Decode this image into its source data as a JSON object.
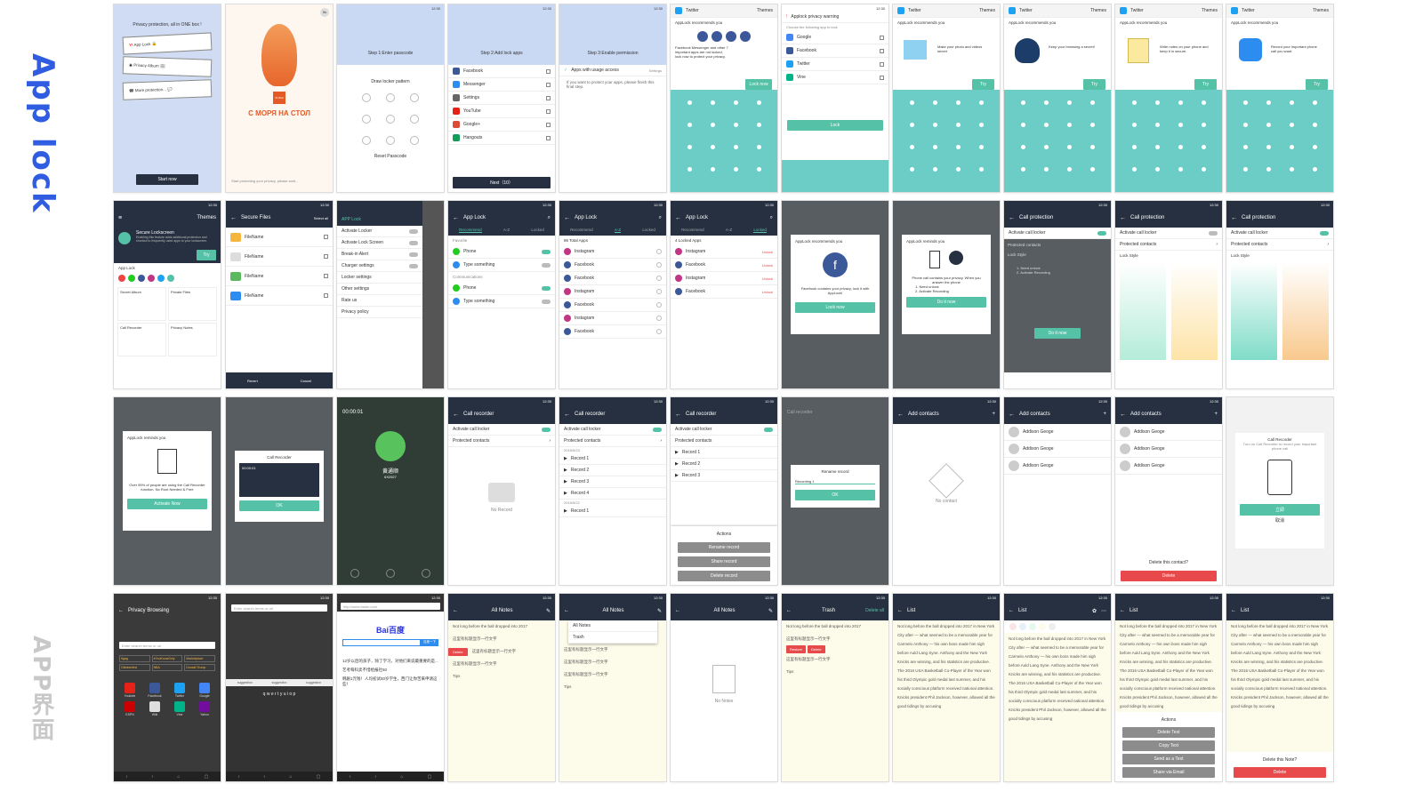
{
  "labels": {
    "app_lock": "App lock",
    "app_ui": "APP界面"
  },
  "colors": {
    "teal": "#6ccdc6",
    "green": "#55c2a8",
    "navy": "#263040",
    "red": "#e8494a",
    "blue_title": "#2f5ce0",
    "grey_title": "#c8c8c8"
  },
  "status_time": "12:30",
  "row1": {
    "p1": {
      "headline": "Privacy protection, all in ONE box !",
      "items": [
        "App Lock",
        "Privacy Album",
        "More protection..."
      ],
      "button": "Start now"
    },
    "p2": {
      "badge": "5s",
      "brand": "SUSHI",
      "slogan": "С МОРЯ НА СТОЛ",
      "footer": "Start protecting your privacy, please wait..."
    },
    "p3": {
      "step": "Step 1:Enter passcode",
      "prompt": "Draw locker pattern",
      "reset": "Reset Passcode"
    },
    "p4": {
      "step": "Step 2:Add lock apps",
      "apps": [
        "Facebook",
        "Messenger",
        "Settings",
        "YouTube",
        "Google+",
        "Hangouts"
      ],
      "next": "Next（10）"
    },
    "p5": {
      "step": "Step 3:Enable permission",
      "perm": "Apps with usage access",
      "settings": "Settings",
      "info": "If you want to protect your apps, please finish this final step."
    },
    "p6": {
      "app": "Twitter",
      "menu": "Themes",
      "title": "AppLock recommends you",
      "desc": "Facebook Messenger and other 7 important apps are not locked, lock now to protect your privacy.",
      "button": "Lock now"
    },
    "p7": {
      "title": "Applock privacy warning",
      "sub": "Choose the following app to lock",
      "apps": [
        "Google",
        "Facebook",
        "Twitter",
        "Vine"
      ],
      "button": "Lock"
    },
    "p8": {
      "app": "Twitter",
      "menu": "Themes",
      "title": "AppLock recommends you",
      "desc": "Make your photo and videos secret",
      "button": "Try"
    },
    "p9": {
      "app": "Twitter",
      "menu": "Themes",
      "title": "AppLock recommends you",
      "desc": "Keep your browsing a secret!",
      "button": "Try"
    },
    "p10": {
      "app": "Twitter",
      "menu": "Themes",
      "title": "AppLock recommends you",
      "desc": "Write notes on your phone and keep it in secure.",
      "button": "Try"
    },
    "p11": {
      "app": "Twitter",
      "menu": "Themes",
      "title": "AppLock recommends you",
      "desc": "Record your important phone call you want.",
      "button": "Try"
    }
  },
  "row2": {
    "p1": {
      "menu": "Themes",
      "title": "Secure Lockscreen",
      "desc": "Enabling this feature adds additional protection and shortcut to frequently used apps to your lockscreen.",
      "try": "Try",
      "section": "App Lock",
      "tiles": [
        "Secret Album",
        "Private Files",
        "Call Recorder",
        "Privacy Notes"
      ]
    },
    "p2": {
      "title": "Secure Files",
      "action": "Select all",
      "files": [
        "FileName",
        "FileName",
        "FileName",
        "FileName"
      ],
      "meta": "3.1 mb 11/25/2016",
      "bottom": [
        "Revert",
        "Cancel"
      ]
    },
    "p3": {
      "brand": "APP Lock",
      "items": [
        "Activate Locker",
        "Activate Lock Screen",
        "Break-in Alert",
        "Charger settings",
        "Locker settings",
        "Other settings",
        "Rate us",
        "Privacy policy"
      ]
    },
    "p4": {
      "title": "App Lock",
      "tabs": [
        "Recommend",
        "A-Z",
        "Locked"
      ],
      "sec1": "Favorite",
      "sec2": "Communications",
      "items": [
        "Phone",
        "Type something",
        "Phone",
        "Type something"
      ]
    },
    "p5": {
      "title": "App Lock",
      "tabs": [
        "Recommend",
        "A-Z",
        "Locked"
      ],
      "count": "86 Total Apps",
      "apps": [
        "Instagram",
        "Facebook",
        "Facebook",
        "Instagram",
        "Facebook",
        "Instagram",
        "Facebook",
        "Instagram",
        "Facebook"
      ]
    },
    "p6": {
      "title": "App Lock",
      "tabs": [
        "Recommend",
        "A-Z",
        "Locked"
      ],
      "count": "4 Locked Apps",
      "apps": [
        "Instagram",
        "Facebook",
        "Instagram",
        "Facebook"
      ],
      "unlock": "Unlock"
    },
    "p7": {
      "title": "AppLock recommends you",
      "desc": "Facebook contains your privacy, lock it with AppLock!",
      "button": "Lock now"
    },
    "p8": {
      "title": "AppLock reminds you",
      "desc": "Phone call contains your privacy. When you answer the phone",
      "steps": [
        "1. Need unlock",
        "2. Activate Recording"
      ],
      "button": "Do it now"
    },
    "p9": {
      "title": "Call protection",
      "item1": "Activate call locker",
      "item2": "Protected contacts",
      "lock_style": "Lock Style",
      "steps": [
        "1. Need unlock",
        "2. Activate Recording"
      ],
      "button": "Do it now"
    },
    "p10": {
      "title": "Call protection",
      "item1": "Activate call locker",
      "item2": "Protected contacts",
      "lock_style": "Lock Style"
    },
    "p11": {
      "title": "Call protection",
      "item1": "Activate call locker",
      "item2": "Protected contacts",
      "lock_style": "Lock Style"
    }
  },
  "row3": {
    "p1": {
      "title": "AppLock reminds you",
      "desc": "Over 95% of people are using the Call Recorder function. No Root Needed & Free",
      "button": "Activate Now"
    },
    "p2": {
      "title": "Call Recorder",
      "timer": "00:00:01",
      "button": "OK"
    },
    "p3": {
      "timer": "00:00:01",
      "name": "黄通顺",
      "sub": "6X2527"
    },
    "p4": {
      "title": "Call recorder",
      "item1": "Activate call locker",
      "item2": "Protected contacts",
      "empty": "No Record"
    },
    "p5": {
      "title": "Call recorder",
      "item1": "Activate call locker",
      "item2": "Protected contacts",
      "records": [
        "Record 1",
        "Record 2",
        "Record 3",
        "Record 4",
        "Record 1"
      ],
      "date1": "2016/5/23",
      "date2": "2016/5/22"
    },
    "p6": {
      "title": "Call recorder",
      "item1": "Activate call locker",
      "item2": "Protected contacts",
      "records": [
        "Record 1",
        "Record 2",
        "Record 3"
      ],
      "actions_title": "Actions",
      "actions": [
        "Rename record",
        "Share record",
        "Delete record"
      ]
    },
    "p7": {
      "title": "Call recorder",
      "dialog": "Rename record",
      "value": "Recording 1",
      "button": "OK"
    },
    "p8": {
      "title": "Add contacts",
      "empty": "No contact"
    },
    "p9": {
      "title": "Add contacts",
      "contacts": [
        "Addison Geoge",
        "Addison Geoge",
        "Addison Geoge"
      ]
    },
    "p10": {
      "title": "Add contacts",
      "contacts": [
        "Addison Geoge",
        "Addison Geoge",
        "Addison Geoge"
      ],
      "confirm": "Delete this contact?",
      "button": "Delete"
    },
    "p11": {
      "title": "Call Recorder",
      "desc": "Turn on Call Recorder to record your important phone call",
      "primary": "立即",
      "secondary": "取消"
    }
  },
  "row4": {
    "p1": {
      "title": "Privacy Browsing",
      "search": "Enter search terms or url",
      "chips": [
        "9gag",
        "#YouKnowOnly",
        "Marketplace",
        "Oktoberfest",
        "NBA",
        "Donald Trump"
      ],
      "apps": [
        "Youtube",
        "Facebook",
        "Twitter",
        "Google",
        "ESPN",
        "Wiki",
        "Vine",
        "Yahoo"
      ]
    },
    "p2": {
      "search": "Enter search terms or url",
      "suggestions": [
        "suggestion",
        "suggestion",
        "suggestion"
      ],
      "keys": "q w e r t y u i o p"
    },
    "p3": {
      "url": "http://www.baidu.com",
      "logo": "Bai百度",
      "button": "百度一下",
      "news1": "12岁以后的孩子，除了学习，对他们来说最重要的是...",
      "news2": "艺考每科卖不惜给报社50",
      "news3": "韩剧1元钱！人均初试50岁学生，西门让你苦来申请这些！"
    },
    "p4": {
      "title": "All Notes",
      "notes": [
        "Not long before the ball dropped into 2017",
        "这里有标题显示一行文字",
        "这里有标题显示一行文字",
        "这里有标题显示一行文字",
        "Tips"
      ],
      "delete": "Delete"
    },
    "p5": {
      "title": "All Notes",
      "menu": [
        "All Notes",
        "Trash"
      ],
      "notes": [
        "这里有标题显示一行文字",
        "这里有标题显示一行文字",
        "这里有标题显示一行文字",
        "Tips"
      ]
    },
    "p6": {
      "title": "All Notes",
      "empty": "No Notes"
    },
    "p7": {
      "title": "Trash",
      "action": "Delete all",
      "notes": [
        "Not long before the ball dropped into 2017",
        "这里有标题显示一行文字",
        "这里有标题显示一行文字",
        "Tips"
      ],
      "buttons": [
        "Restore",
        "Delete"
      ]
    },
    "p8": {
      "title": "List",
      "text": "Not long before the ball dropped into 2017 in New York City after — what seemed to be a memorable year for Carmelo Anthony — his own boss made him sigh before Auld Lang Syne. Anthony and the New York Knicks are winning, and his statistics are productive. The 2016 USA Basketball Co-Player of the Year won his third Olympic gold medal last summer, and his socially conscious platform received national attention. Knicks president Phil Jackson, however, allowed all the good tidings by accusing"
    },
    "p9": {
      "title": "List"
    },
    "p10": {
      "title": "List",
      "actions_title": "Actions",
      "actions": [
        "Delete Text",
        "Copy Text",
        "Send as a Text",
        "Share via Email"
      ]
    },
    "p11": {
      "title": "List",
      "confirm": "Delete this Note?",
      "button": "Delete"
    }
  }
}
